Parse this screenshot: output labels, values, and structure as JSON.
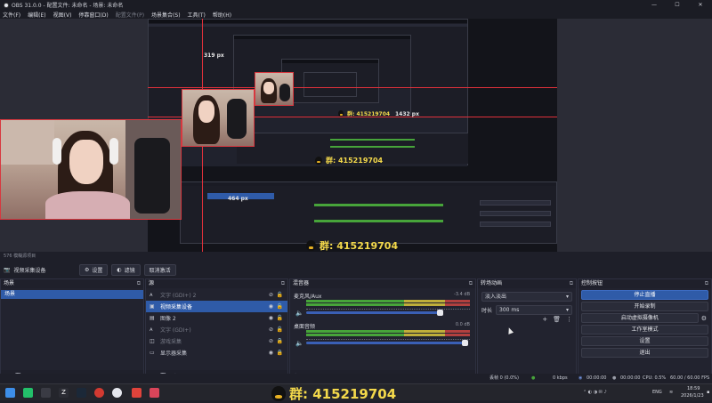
{
  "window": {
    "title": "OBS 31.0.0 - 配置文件: 未命名 - 场景: 未命名",
    "controls": [
      "—",
      "☐",
      "✕"
    ]
  },
  "menu": [
    "文件(F)",
    "编辑(E)",
    "视图(V)",
    "停靠窗口(D)",
    "配置文件(P)",
    "场景集合(S)",
    "工具(T)",
    "帮助(H)"
  ],
  "preview": {
    "label_top": "319 px",
    "label_right": "1432 px",
    "label_left": "464 px",
    "qq_group_small": "群: 415219704",
    "qq_group_mid": "群: 415219704"
  },
  "thin_label": "576    模糊源项目",
  "source_toolbar": {
    "current_source": "视频采集设备",
    "settings_label": "设置",
    "filters_label": "滤镜",
    "deactivate_label": "取消激活"
  },
  "scenes": {
    "title": "场景",
    "items": [
      "场景"
    ]
  },
  "sources": {
    "title": "源",
    "items": [
      {
        "label": "文字 (GDI+) 2",
        "icon": "text-icon",
        "state": "dim"
      },
      {
        "label": "视频采集设备",
        "icon": "camera-icon",
        "state": "selected"
      },
      {
        "label": "图像 2",
        "icon": "image-icon",
        "state": "normal"
      },
      {
        "label": "文字 (GDI+)",
        "icon": "text-icon",
        "state": "dim"
      },
      {
        "label": "游戏采集",
        "icon": "gamepad-icon",
        "state": "dim"
      },
      {
        "label": "显示器采集",
        "icon": "monitor-icon",
        "state": "normal"
      }
    ]
  },
  "mixer": {
    "title": "混音器",
    "channels": [
      {
        "name": "麦克风/Aux",
        "db": "-3.4 dB"
      },
      {
        "name": "桌面音频",
        "db": "0.0 dB"
      }
    ]
  },
  "transitions": {
    "title": "转场动画",
    "selected": "淡入淡出",
    "duration_label": "时长",
    "duration_value": "300 ms"
  },
  "controls": {
    "title": "控制按钮",
    "buttons": [
      "停止直播",
      "开始录制",
      "启动虚拟摄像机",
      "工作室模式",
      "设置",
      "退出"
    ]
  },
  "status": {
    "dropped": "丢帧 0 (0.0%)",
    "kbps": "0 kbps",
    "stream_time": "00:00:00",
    "rec_time": "00:00:00",
    "cpu": "CPU: 0.5%",
    "fps": "60.00 / 60.00 FPS"
  },
  "taskbar": {
    "lang": "ENG",
    "time": "18:59",
    "date": "2026/1/23",
    "banner": "群: 415219704"
  },
  "colors": {
    "accent": "#2f5ba8",
    "red_guide": "#e0313b",
    "banner_yellow": "#f4d94b"
  }
}
